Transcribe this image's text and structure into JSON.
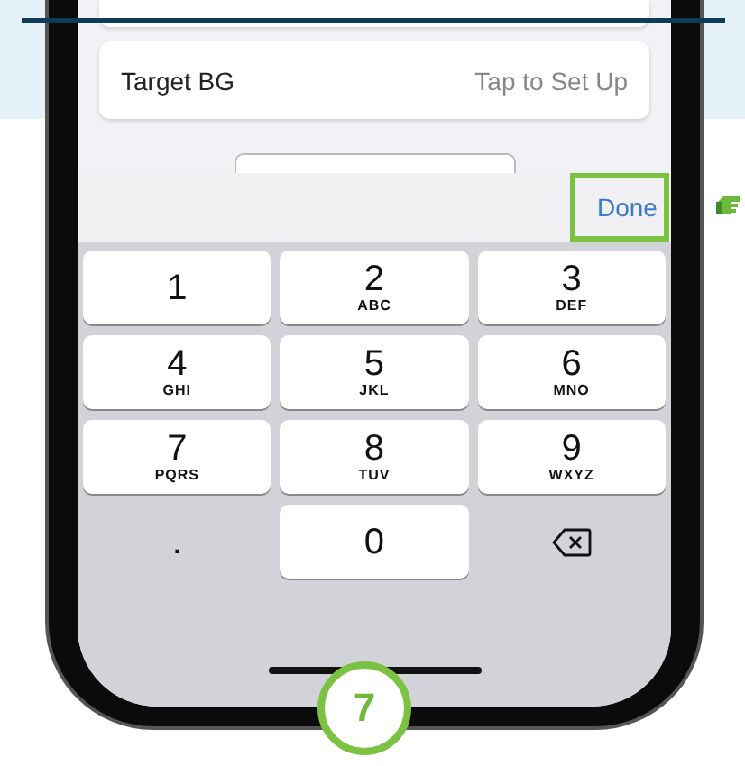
{
  "settings_rows": [
    {
      "label": "Target BG",
      "value": "Tap to Set Up"
    }
  ],
  "toolbar": {
    "done_button": {
      "label": "Done",
      "highlighted": true
    }
  },
  "keypad": [
    {
      "kind": "digit",
      "digit": "1"
    },
    {
      "kind": "digit",
      "digit": "2",
      "letters": "ABC"
    },
    {
      "kind": "digit",
      "digit": "3",
      "letters": "DEF"
    },
    {
      "kind": "digit",
      "digit": "4",
      "letters": "GHI"
    },
    {
      "kind": "digit",
      "digit": "5",
      "letters": "JKL"
    },
    {
      "kind": "digit",
      "digit": "6",
      "letters": "MNO"
    },
    {
      "kind": "digit",
      "digit": "7",
      "letters": "PQRS"
    },
    {
      "kind": "digit",
      "digit": "8",
      "letters": "TUV"
    },
    {
      "kind": "digit",
      "digit": "9",
      "letters": "WXYZ"
    },
    {
      "kind": "dot",
      "digit": "."
    },
    {
      "kind": "digit",
      "digit": "0"
    },
    {
      "kind": "backspace"
    }
  ],
  "step_badge": "7"
}
